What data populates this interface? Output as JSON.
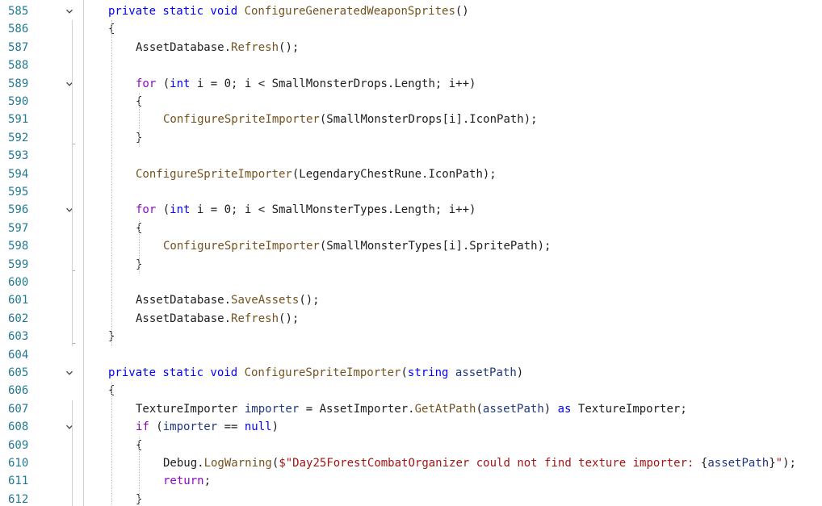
{
  "editor": {
    "lines": [
      {
        "n": "585",
        "fold": true,
        "indent": 0,
        "tokens": [
          [
            "kw",
            "private static void "
          ],
          [
            "fn",
            "ConfigureGeneratedWeaponSprites"
          ],
          [
            "",
            "()"
          ]
        ]
      },
      {
        "n": "586",
        "fold": false,
        "indent": 0,
        "tokens": [
          [
            "",
            "{"
          ]
        ]
      },
      {
        "n": "587",
        "fold": false,
        "indent": 1,
        "tokens": [
          [
            "",
            "AssetDatabase."
          ],
          [
            "fn",
            "Refresh"
          ],
          [
            "",
            "();"
          ]
        ]
      },
      {
        "n": "588",
        "fold": false,
        "indent": 0,
        "tokens": []
      },
      {
        "n": "589",
        "fold": true,
        "indent": 1,
        "tokens": [
          [
            "ctl",
            "for"
          ],
          [
            "",
            " ("
          ],
          [
            "kw",
            "int"
          ],
          [
            "",
            " i = 0; i < SmallMonsterDrops.Length; i++)"
          ]
        ]
      },
      {
        "n": "590",
        "fold": false,
        "indent": 1,
        "tokens": [
          [
            "",
            "{"
          ]
        ]
      },
      {
        "n": "591",
        "fold": false,
        "indent": 2,
        "tokens": [
          [
            "fn",
            "ConfigureSpriteImporter"
          ],
          [
            "",
            "(SmallMonsterDrops[i].IconPath);"
          ]
        ]
      },
      {
        "n": "592",
        "fold": false,
        "indent": 1,
        "tokens": [
          [
            "",
            "}"
          ]
        ]
      },
      {
        "n": "593",
        "fold": false,
        "indent": 0,
        "tokens": []
      },
      {
        "n": "594",
        "fold": false,
        "indent": 1,
        "tokens": [
          [
            "fn",
            "ConfigureSpriteImporter"
          ],
          [
            "",
            "(LegendaryChestRune.IconPath);"
          ]
        ]
      },
      {
        "n": "595",
        "fold": false,
        "indent": 0,
        "tokens": []
      },
      {
        "n": "596",
        "fold": true,
        "indent": 1,
        "tokens": [
          [
            "ctl",
            "for"
          ],
          [
            "",
            " ("
          ],
          [
            "kw",
            "int"
          ],
          [
            "",
            " i = 0; i < SmallMonsterTypes.Length; i++)"
          ]
        ]
      },
      {
        "n": "597",
        "fold": false,
        "indent": 1,
        "tokens": [
          [
            "",
            "{"
          ]
        ]
      },
      {
        "n": "598",
        "fold": false,
        "indent": 2,
        "tokens": [
          [
            "fn",
            "ConfigureSpriteImporter"
          ],
          [
            "",
            "(SmallMonsterTypes[i].SpritePath);"
          ]
        ]
      },
      {
        "n": "599",
        "fold": false,
        "indent": 1,
        "tokens": [
          [
            "",
            "}"
          ]
        ]
      },
      {
        "n": "600",
        "fold": false,
        "indent": 0,
        "tokens": []
      },
      {
        "n": "601",
        "fold": false,
        "indent": 1,
        "tokens": [
          [
            "",
            "AssetDatabase."
          ],
          [
            "fn",
            "SaveAssets"
          ],
          [
            "",
            "();"
          ]
        ]
      },
      {
        "n": "602",
        "fold": false,
        "indent": 1,
        "tokens": [
          [
            "",
            "AssetDatabase."
          ],
          [
            "fn",
            "Refresh"
          ],
          [
            "",
            "();"
          ]
        ]
      },
      {
        "n": "603",
        "fold": false,
        "indent": 0,
        "tokens": [
          [
            "",
            "}"
          ]
        ]
      },
      {
        "n": "604",
        "fold": false,
        "indent": 0,
        "tokens": []
      },
      {
        "n": "605",
        "fold": true,
        "indent": 0,
        "tokens": [
          [
            "kw",
            "private static void "
          ],
          [
            "fn",
            "ConfigureSpriteImporter"
          ],
          [
            "",
            "("
          ],
          [
            "kw",
            "string "
          ],
          [
            "param",
            "assetPath"
          ],
          [
            "",
            ")"
          ]
        ]
      },
      {
        "n": "606",
        "fold": false,
        "indent": 0,
        "tokens": [
          [
            "",
            "{"
          ]
        ]
      },
      {
        "n": "607",
        "fold": false,
        "indent": 1,
        "tokens": [
          [
            "",
            "TextureImporter "
          ],
          [
            "param",
            "importer"
          ],
          [
            "",
            " = AssetImporter."
          ],
          [
            "fn",
            "GetAtPath"
          ],
          [
            "",
            "("
          ],
          [
            "param",
            "assetPath"
          ],
          [
            "",
            ") "
          ],
          [
            "kw",
            "as"
          ],
          [
            "",
            " TextureImporter;"
          ]
        ]
      },
      {
        "n": "608",
        "fold": true,
        "indent": 1,
        "tokens": [
          [
            "ctl",
            "if"
          ],
          [
            "",
            " ("
          ],
          [
            "param",
            "importer"
          ],
          [
            "",
            " == "
          ],
          [
            "kw",
            "null"
          ],
          [
            "",
            ")"
          ]
        ]
      },
      {
        "n": "609",
        "fold": false,
        "indent": 1,
        "tokens": [
          [
            "",
            "{"
          ]
        ]
      },
      {
        "n": "610",
        "fold": false,
        "indent": 2,
        "tokens": [
          [
            "",
            "Debug."
          ],
          [
            "fn",
            "LogWarning"
          ],
          [
            "",
            "("
          ],
          [
            "str",
            "$\"Day25ForestCombatOrganizer could not find texture importer: "
          ],
          [
            "",
            "{"
          ],
          [
            "param",
            "assetPath"
          ],
          [
            "",
            "}"
          ],
          [
            "str",
            "\""
          ],
          [
            "",
            ");"
          ]
        ]
      },
      {
        "n": "611",
        "fold": false,
        "indent": 2,
        "tokens": [
          [
            "ctl",
            "return"
          ],
          [
            "",
            ";"
          ]
        ]
      },
      {
        "n": "612",
        "fold": false,
        "indent": 1,
        "tokens": [
          [
            "",
            "}"
          ]
        ]
      }
    ]
  }
}
